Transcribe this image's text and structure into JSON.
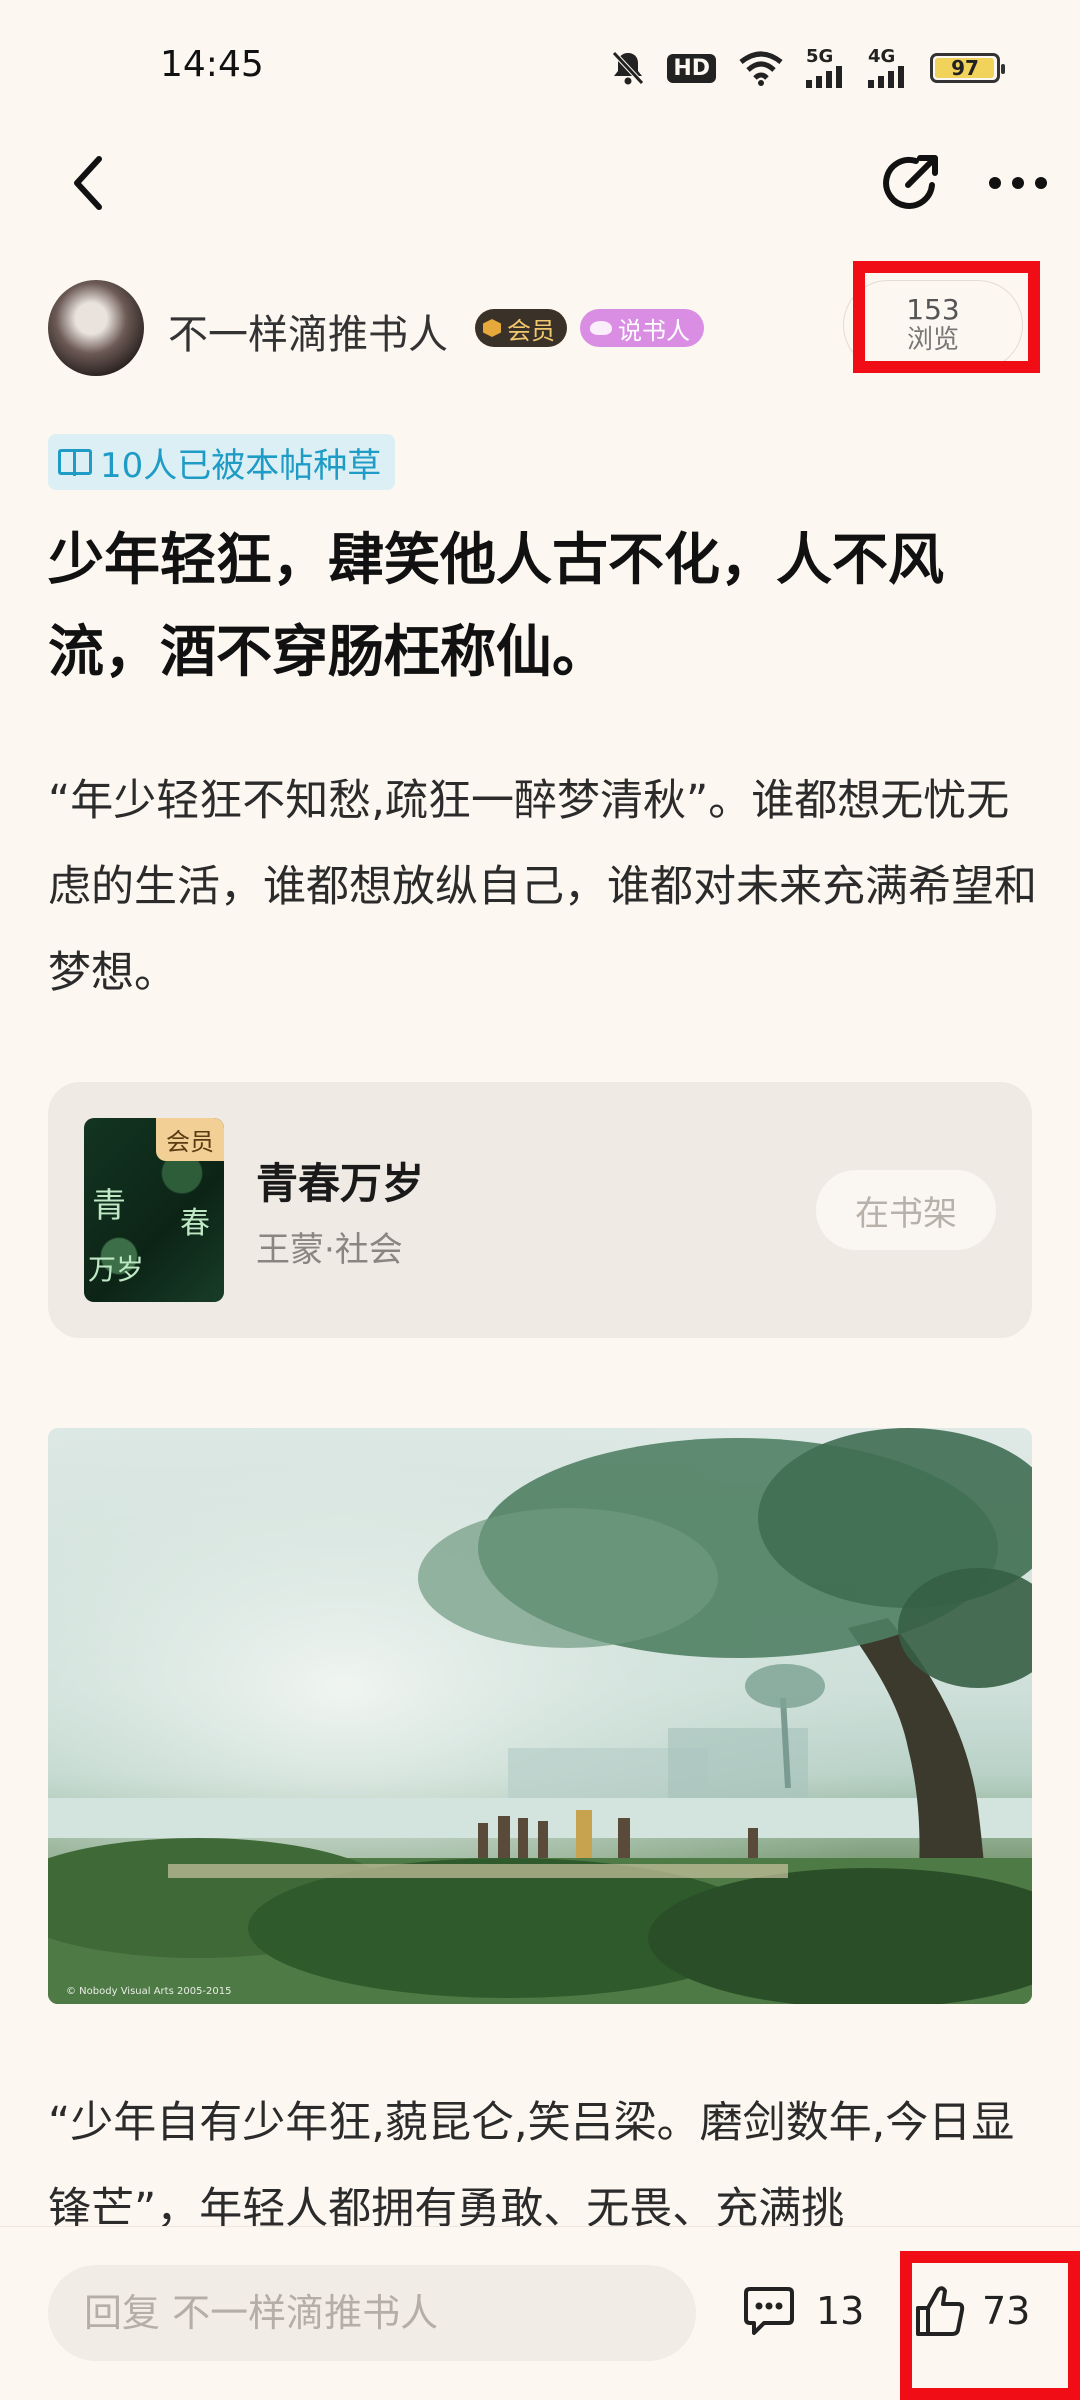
{
  "status_bar": {
    "time": "14:45",
    "hd_label": "HD",
    "net1": "5G",
    "net2": "4G",
    "battery": "97"
  },
  "nav": {
    "back_icon": "chevron-left-icon",
    "share_icon": "share-icon",
    "more_icon": "more-dots-icon"
  },
  "author": {
    "name": "不一样滴推书人",
    "badge_vip": "会员",
    "badge_teller": "说书人",
    "views_count": "153",
    "views_label": "浏览"
  },
  "post": {
    "tag": "10人已被本帖种草",
    "title": "少年轻狂，肆笑他人古不化，人不风流，酒不穿肠枉称仙。",
    "para1": "“年少轻狂不知愁,疏狂一醉梦清秋”。谁都想无忧无虑的生活，谁都想放纵自己，谁都对未来充满希望和梦想。",
    "para2": "“少年自有少年狂,藐昆仑,笑吕梁。磨剑数年,今日显锋芒”，年轻人都拥有勇敢、无畏、充满挑"
  },
  "book": {
    "cover_badge": "会员",
    "cover_char1": "青",
    "cover_char2": "春",
    "cover_char3": "万岁",
    "title": "青春万岁",
    "meta": "王蒙·社会",
    "shelf_label": "在书架"
  },
  "photo": {
    "caption": "© Nobody Visual Arts 2005-2015"
  },
  "bottom_bar": {
    "reply_placeholder": "回复 不一样滴推书人",
    "comment_count": "13",
    "like_count": "73"
  },
  "colors": {
    "background": "#fcf7f1",
    "highlight_red": "#f10d16",
    "tag_blue": "#1f9cc6",
    "vip_gold": "#f3c86f",
    "teller_pink": "#d98ee4"
  }
}
